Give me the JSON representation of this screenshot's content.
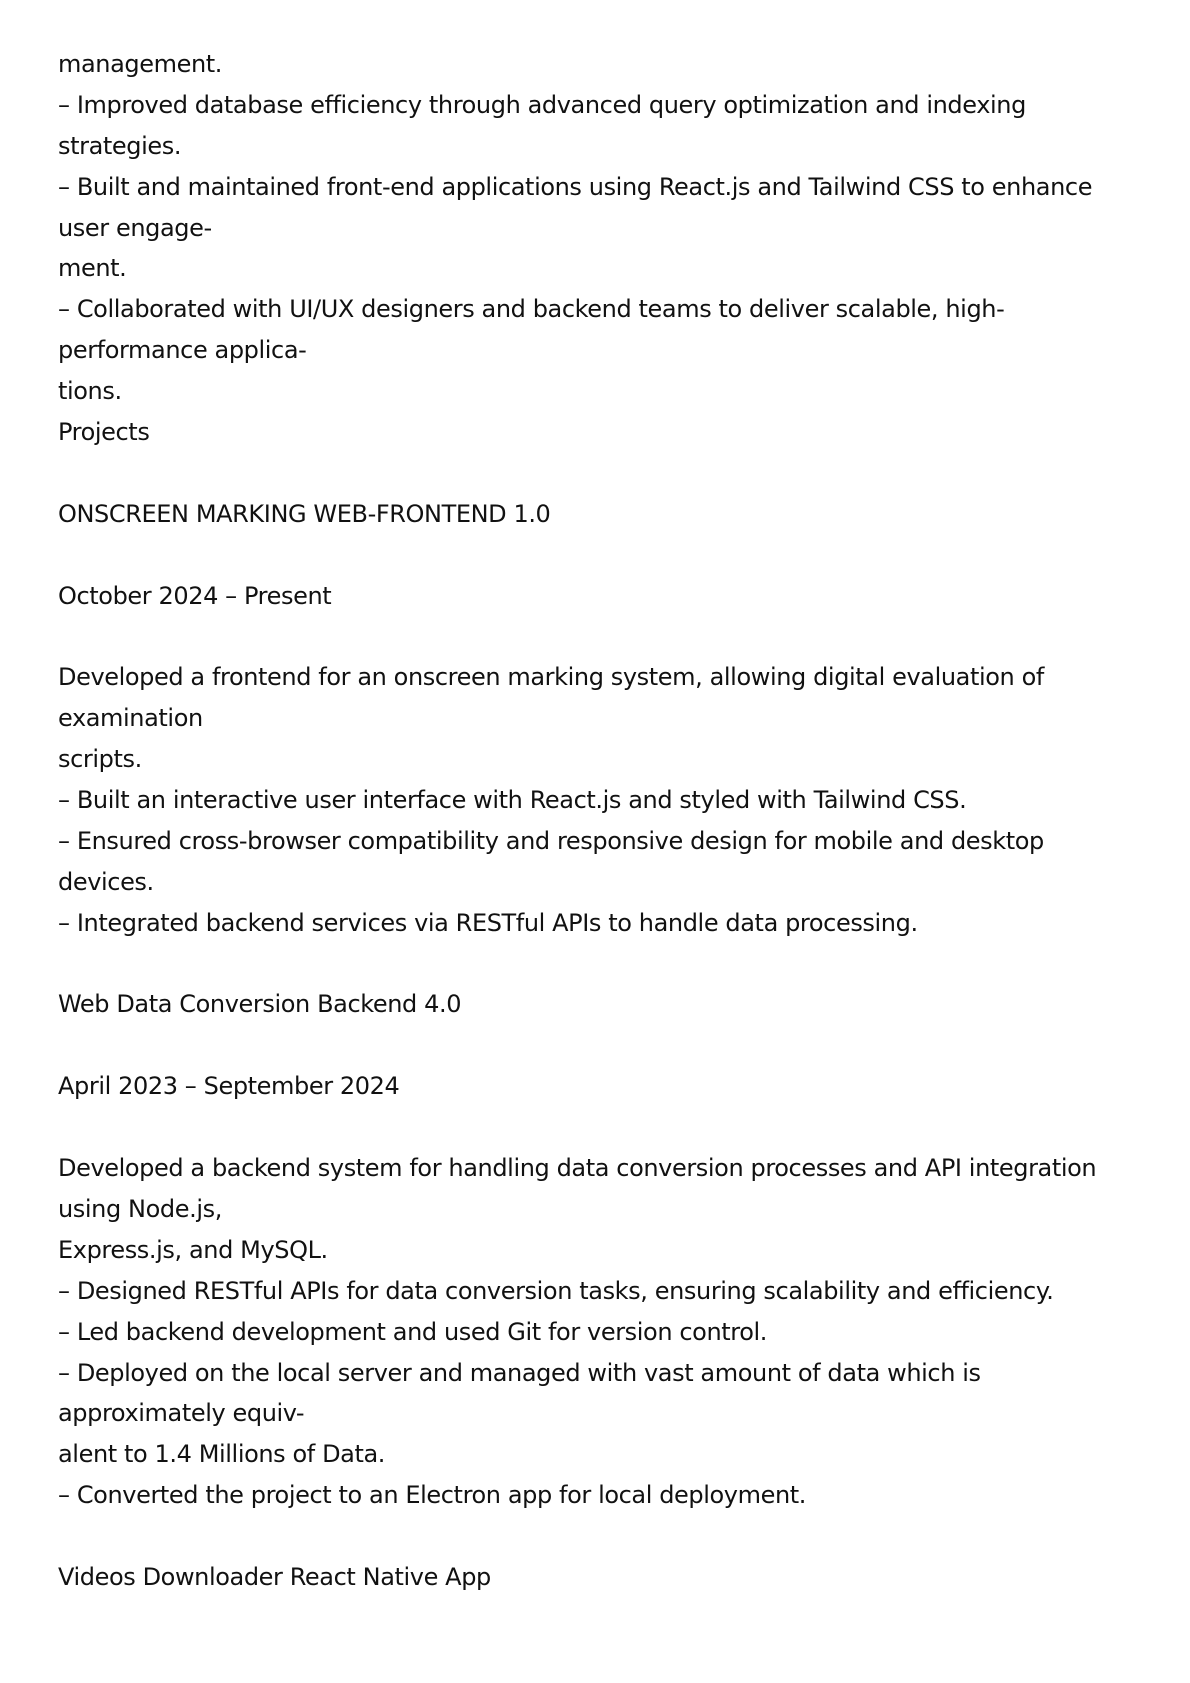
{
  "lines": [
    "management.",
    "– Improved database efficiency through advanced query optimization and indexing",
    "strategies.",
    "– Built and maintained front-end applications using React.js and Tailwind CSS to enhance",
    "user engage-",
    "ment.",
    "– Collaborated with UI/UX designers and backend teams to deliver scalable, high-",
    "performance applica-",
    "tions.",
    "Projects",
    "",
    "ONSCREEN MARKING WEB-FRONTEND 1.0",
    "",
    "October 2024 – Present",
    "",
    "Developed a frontend for an onscreen marking system, allowing digital evaluation of",
    "examination",
    "scripts.",
    "– Built an interactive user interface with React.js and styled with Tailwind CSS.",
    "– Ensured cross-browser compatibility and responsive design for mobile and desktop",
    "devices.",
    "– Integrated backend services via RESTful APIs to handle data processing.",
    "",
    "Web Data Conversion Backend 4.0",
    "",
    "April 2023 – September 2024",
    "",
    "Developed a backend system for handling data conversion processes and API integration",
    "using Node.js,",
    "Express.js, and MySQL.",
    "– Designed RESTful APIs for data conversion tasks, ensuring scalability and efficiency.",
    "– Led backend development and used Git for version control.",
    "– Deployed on the local server and managed with vast amount of data which is",
    "approximately equiv-",
    "alent to 1.4 Millions of Data.",
    "– Converted the project to an Electron app for local deployment.",
    "",
    "Videos Downloader React Native App"
  ]
}
